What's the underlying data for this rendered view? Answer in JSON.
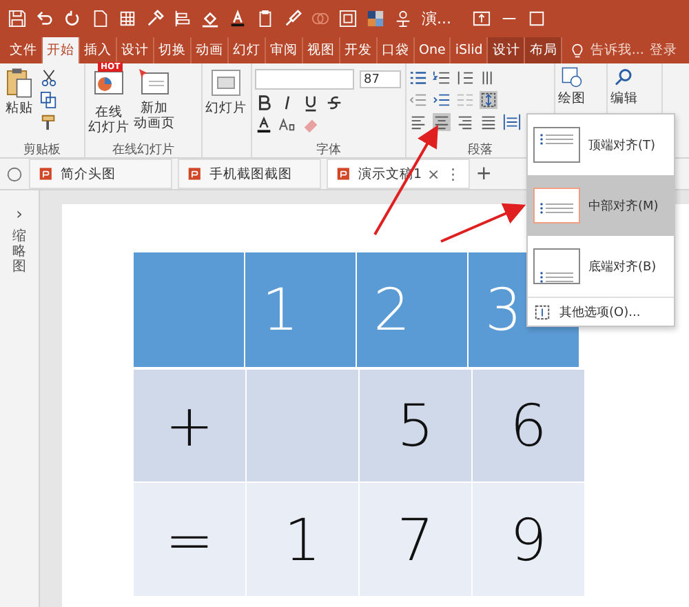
{
  "title_bar": {
    "title": "演..."
  },
  "ribbon_tabs": [
    {
      "label": "文件",
      "selected": false,
      "contextual": false
    },
    {
      "label": "开始",
      "selected": true,
      "contextual": false
    },
    {
      "label": "插入",
      "selected": false,
      "contextual": false
    },
    {
      "label": "设计",
      "selected": false,
      "contextual": false
    },
    {
      "label": "切换",
      "selected": false,
      "contextual": false
    },
    {
      "label": "动画",
      "selected": false,
      "contextual": false
    },
    {
      "label": "幻灯",
      "selected": false,
      "contextual": false
    },
    {
      "label": "审阅",
      "selected": false,
      "contextual": false
    },
    {
      "label": "视图",
      "selected": false,
      "contextual": false
    },
    {
      "label": "开发",
      "selected": false,
      "contextual": false
    },
    {
      "label": "口袋",
      "selected": false,
      "contextual": false
    },
    {
      "label": "One",
      "selected": false,
      "contextual": false
    },
    {
      "label": "iSlid",
      "selected": false,
      "contextual": false
    },
    {
      "label": "设计",
      "selected": false,
      "contextual": true
    },
    {
      "label": "布局",
      "selected": false,
      "contextual": true
    }
  ],
  "tell_me": "告诉我...",
  "sign_in": "登录",
  "ribbon": {
    "paste": "粘贴",
    "clipboard_label": "剪贴板",
    "hot": "HOT",
    "online_slides": [
      "在线",
      "幻灯片"
    ],
    "new_animation": [
      "新加",
      "动画页"
    ],
    "online_label": "在线幻灯片",
    "slides": "幻灯片",
    "font_size": "87",
    "font_label": "字体",
    "paragraph_label": "段落",
    "drawing": "绘图",
    "editing": "编辑",
    "alignments": [
      {
        "selected": false
      },
      {
        "selected": true
      },
      {
        "selected": false
      },
      {
        "selected": false
      }
    ],
    "align_text_expanded": true
  },
  "doc_tabs": [
    {
      "label": "简介头图",
      "selected": false
    },
    {
      "label": "手机截图截图",
      "selected": false
    },
    {
      "label": "演示文稿1",
      "selected": true
    }
  ],
  "doc_tab_close": "×",
  "doc_tab_more": "⋮",
  "doc_tab_add": "+",
  "thumbnail_pane": {
    "toggle": "›",
    "label": "缩略图"
  },
  "table": {
    "rows": [
      [
        null,
        "1",
        "2",
        "3"
      ],
      [
        "+",
        null,
        "5",
        "6"
      ],
      [
        "=",
        "1",
        "7",
        "9"
      ]
    ]
  },
  "align_menu": {
    "items": [
      {
        "label": "顶端对齐(T)",
        "kind": "top",
        "selected": false
      },
      {
        "label": "中部对齐(M)",
        "kind": "middle",
        "selected": true
      },
      {
        "label": "底端对齐(B)",
        "kind": "bottom",
        "selected": false
      }
    ],
    "more_options": "其他选项(O)..."
  }
}
